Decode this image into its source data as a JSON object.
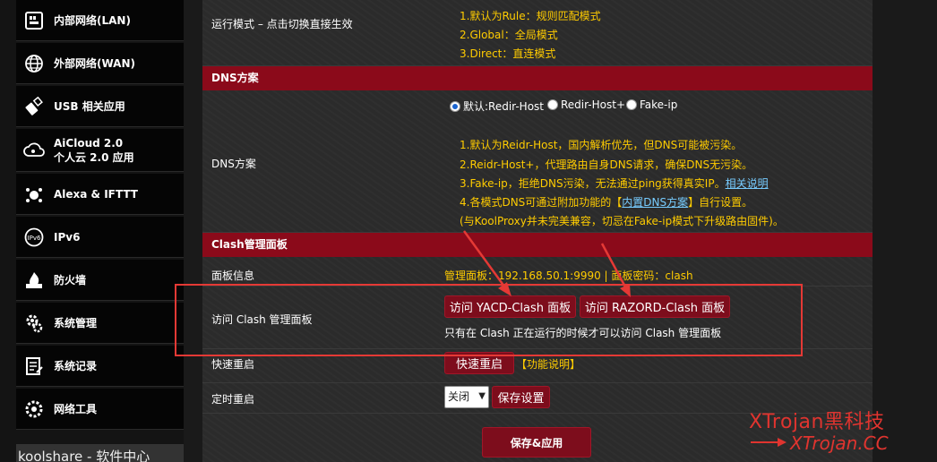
{
  "sidebar": {
    "items": [
      {
        "label": "内部网络(LAN)",
        "icon": "lan-icon"
      },
      {
        "label": "外部网络(WAN)",
        "icon": "globe-icon"
      },
      {
        "label": "USB 相关应用",
        "icon": "usb-icon"
      },
      {
        "label": "AiCloud 2.0",
        "label2": "个人云 2.0 应用",
        "icon": "cloud-icon"
      },
      {
        "label": "Alexa & IFTTT",
        "icon": "alexa-icon"
      },
      {
        "label": "IPv6",
        "icon": "ipv6-icon"
      },
      {
        "label": "防火墙",
        "icon": "firewall-icon"
      },
      {
        "label": "系统管理",
        "icon": "admin-gear-icon"
      },
      {
        "label": "系统记录",
        "icon": "log-icon"
      },
      {
        "label": "网络工具",
        "icon": "network-tools-icon"
      }
    ],
    "bottom": "koolshare - 软件中心"
  },
  "run_mode": {
    "label": "运行模式 – 点击切换直接生效",
    "notes": [
      "1.默认为Rule：规则匹配模式",
      "2.Global：全局模式",
      "3.Direct：直连模式"
    ]
  },
  "dns_section": {
    "title": "DNS方案",
    "label": "DNS方案",
    "options": [
      "默认:Redir-Host",
      "Redir-Host+",
      "Fake-ip"
    ],
    "selected": "默认:Redir-Host",
    "notes": {
      "n1": "1.默认为Reidr-Host，国内解析优先，但DNS可能被污染。",
      "n2": "2.Reidr-Host+，代理路由自身DNS请求，确保DNS无污染。",
      "n3": "3.Fake-ip，拒绝DNS污染，无法通过ping获得真实IP。",
      "n3_link": "相关说明",
      "n4_pre": "4.各模式DNS可通过附加功能的【",
      "n4_link": "内置DNS方案",
      "n4_post": "】自行设置。",
      "n5": "(与KoolProxy并未完美兼容，切忌在Fake-ip模式下升级路由固件)。"
    }
  },
  "clash_section": {
    "title": "Clash管理面板",
    "panel_info_label": "面板信息",
    "panel_info_value": "管理面板：192.168.50.1:9990 | 面板密码：clash",
    "visit_label": "访问 Clash 管理面板",
    "yacd_button": "访问 YACD-Clash 面板",
    "razord_button": "访问 RAZORD-Clash 面板",
    "visit_hint": "只有在 Clash 正在运行的时候才可以访问 Clash 管理面板",
    "quick_restart_label": "快速重启",
    "quick_restart_button": "快速重启",
    "quick_restart_help": "【功能说明】",
    "timed_restart_label": "定时重启",
    "timed_restart_select": "关闭",
    "save_settings_button": "保存设置"
  },
  "save_apply_button": "保存&应用",
  "watermark": {
    "line1": "XTrojan黑科技",
    "line2": "XTrojan.CC"
  },
  "colors": {
    "accent": "#8b0a1a",
    "note": "#ffcc00",
    "annotation": "#e53935"
  }
}
